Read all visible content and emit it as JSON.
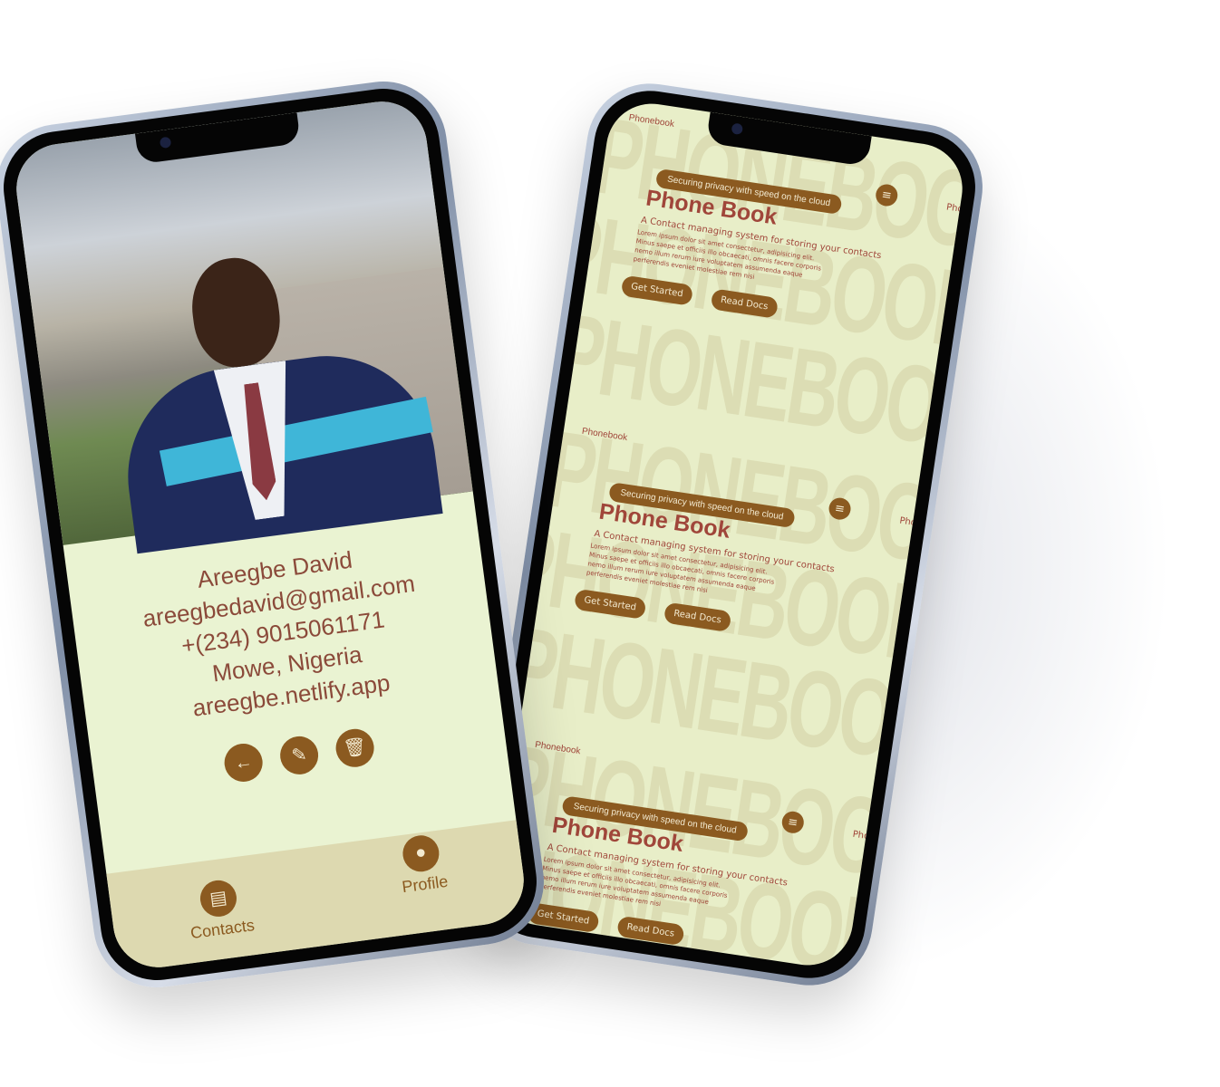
{
  "contact_screen": {
    "name": "Areegbe David",
    "email": "areegbedavid@gmail.com",
    "phone": "+(234) 9015061171",
    "location": "Mowe, Nigeria",
    "website": "areegbe.netlify.app",
    "actions": [
      {
        "icon": "arrow-left-icon",
        "glyph": "←"
      },
      {
        "icon": "edit-icon",
        "glyph": "✎"
      },
      {
        "icon": "trash-icon",
        "glyph": "🗑"
      }
    ],
    "tabs": [
      {
        "label": "Contacts",
        "icon": "contacts-icon",
        "glyph": "▤"
      },
      {
        "label": "Profile",
        "icon": "user-icon",
        "glyph": "●"
      }
    ]
  },
  "landing_screen": {
    "brand": "Phonebook",
    "brand_cut": "Phon",
    "menu_glyph": "≡",
    "background_word": "PHONEBOOKP",
    "tagline": "Securing privacy with speed on the cloud",
    "title": "Phone Book",
    "subtitle": "A Contact managing system for storing your contacts",
    "lorem": "Lorem ipsum dolor sit amet consectetur, adipisicing elit. Minus saepe et officiis illo obcaecati, omnis facere corporis nemo illum rerum iure voluptatem assumenda eaque perferendis eveniet molestiae rem nisi",
    "get_started": "Get Started",
    "read_docs": "Read Docs"
  },
  "colors": {
    "accent": "#8b5a20",
    "text": "#a0463a",
    "background": "#eaf3d2",
    "tabbar": "#ddd9b0"
  }
}
